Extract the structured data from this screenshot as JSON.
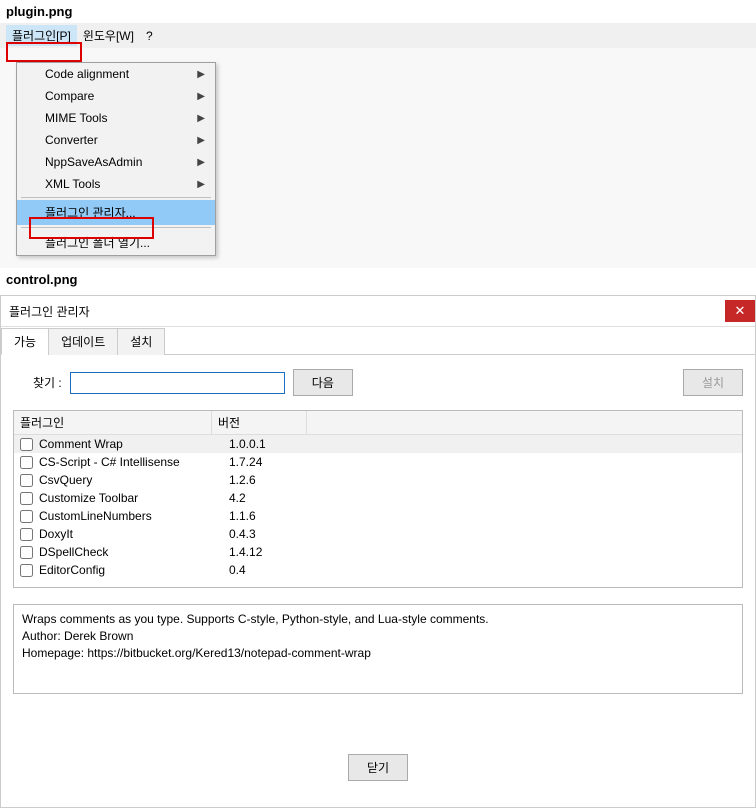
{
  "section1_label": "plugin.png",
  "menubar": {
    "plugin": "플러그인[P]",
    "window": "윈도우[W]",
    "help": "?"
  },
  "dropdown": {
    "items": [
      "Code alignment",
      "Compare",
      "MIME Tools",
      "Converter",
      "NppSaveAsAdmin",
      "XML Tools"
    ],
    "manager": "플러그인 관리자...",
    "open_folder": "플러그인 폴더 열기..."
  },
  "section2_label": "control.png",
  "dialog": {
    "title": "플러그인 관리자",
    "tabs": {
      "available": "가능",
      "update": "업데이트",
      "installed": "설치"
    },
    "search_label": "찾기 :",
    "next_btn": "다음",
    "install_btn": "설치",
    "columns": {
      "name": "플러그인",
      "version": "버전"
    },
    "rows": [
      {
        "name": "Comment Wrap",
        "version": "1.0.0.1"
      },
      {
        "name": "CS-Script - C# Intellisense",
        "version": "1.7.24"
      },
      {
        "name": "CsvQuery",
        "version": "1.2.6"
      },
      {
        "name": "Customize Toolbar",
        "version": "4.2"
      },
      {
        "name": "CustomLineNumbers",
        "version": "1.1.6"
      },
      {
        "name": "DoxyIt",
        "version": "0.4.3"
      },
      {
        "name": "DSpellCheck",
        "version": "1.4.12"
      },
      {
        "name": "EditorConfig",
        "version": "0.4"
      }
    ],
    "description": {
      "line1": "Wraps comments as you type. Supports C-style, Python-style, and Lua-style comments.",
      "line2": "Author: Derek Brown",
      "line3": "Homepage: https://bitbucket.org/Kered13/notepad-comment-wrap"
    },
    "close_btn": "닫기"
  }
}
